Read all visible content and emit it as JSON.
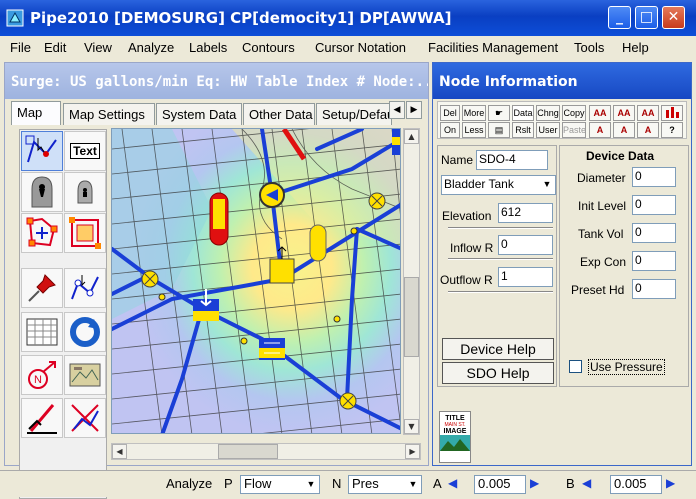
{
  "window": {
    "title": "Pipe2010  [DEMOSURG]  CP[democity1]  DP[AWWA]"
  },
  "menu": [
    "File",
    "Edit",
    "View",
    "Analyze",
    "Labels",
    "Contours",
    "Cursor Notation",
    "Facilities Management",
    "Tools",
    "Help"
  ],
  "map_window": {
    "header": "Surge: US gallons/min  Eq: HW  Table Index #  Node:...",
    "tabs": [
      "Map",
      "Map Settings",
      "System Data",
      "Other Data",
      "Setup/Defau"
    ],
    "tools": [
      "select-tool",
      "text-tool",
      "node-tool-large",
      "node-tool-small",
      "polygon-select-tool",
      "zoom-box-tool",
      "pin-tool",
      "network-tool",
      "table-tool",
      "refresh-tool",
      "north-arrow-tool",
      "image-tool",
      "profile-tool",
      "delete-tool"
    ],
    "text_tool_label": "Text"
  },
  "node_info": {
    "header": "Node Information",
    "toolbar_row1": [
      "Del",
      "More",
      "",
      "Data",
      "Chng",
      "Copy"
    ],
    "toolbar_row2": [
      "On",
      "Less",
      "",
      "Rslt",
      "User",
      "Paste"
    ],
    "name_label": "Name",
    "name_value": "SDO-4",
    "type_value": "Bladder Tank",
    "elevation_label": "Elevation",
    "elevation_value": "612",
    "inflow_label": "Inflow R",
    "inflow_value": "0",
    "outflow_label": "Outflow R",
    "outflow_value": "1",
    "device_header": "Device Data",
    "device_fields": [
      {
        "label": "Diameter",
        "value": "0"
      },
      {
        "label": "Init Level",
        "value": "0"
      },
      {
        "label": "Tank Vol",
        "value": "0"
      },
      {
        "label": "Exp Con",
        "value": "0"
      },
      {
        "label": "Preset Hd",
        "value": "0"
      }
    ],
    "use_pressure_label": "Use Pressure",
    "device_help": "Device Help",
    "sdo_help": "SDO Help",
    "thumb_text": [
      "TITLE",
      "MAIN ST.",
      "IMAGE"
    ]
  },
  "status": {
    "analyze": "Analyze",
    "p_label": "P",
    "p_value": "Flow",
    "n_label": "N",
    "n_value": "Pres",
    "a_label": "A",
    "a_value": "0.005",
    "b_label": "B",
    "b_value": "0.005"
  },
  "colors": {
    "title_blue": "#0a3fc2",
    "pipe_blue": "#1a3fd6",
    "pipe_red": "#e01010",
    "node_yellow": "#ffe000"
  }
}
